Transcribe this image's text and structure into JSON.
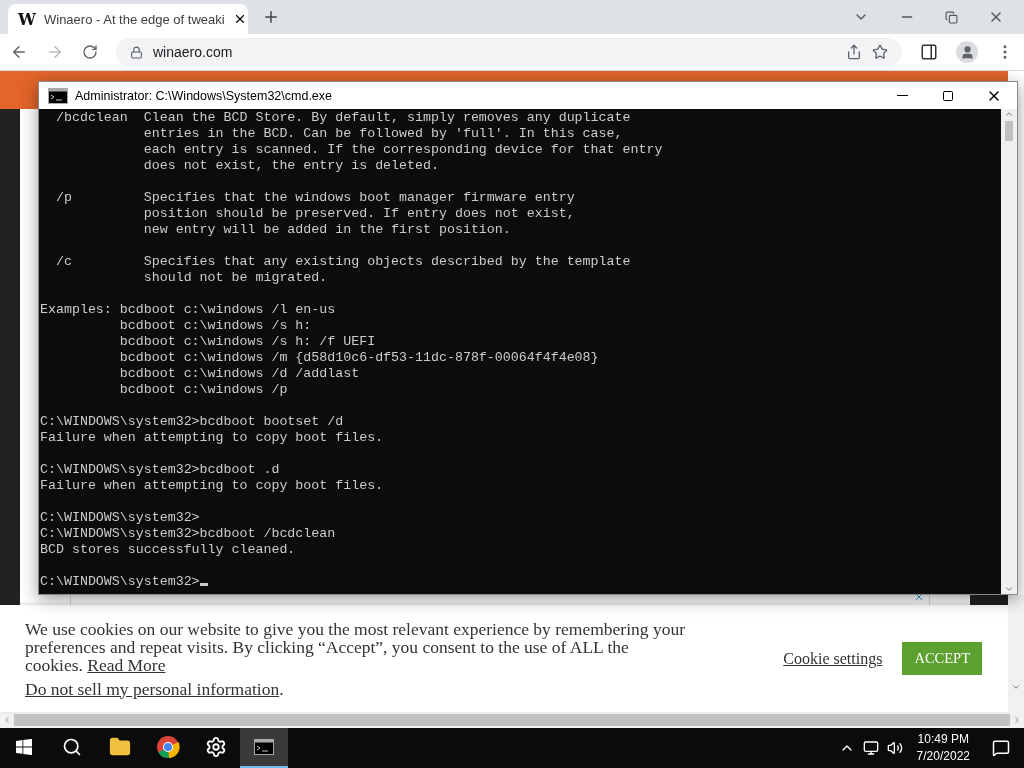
{
  "browser": {
    "tab": {
      "favicon": "W",
      "title": "Winaero - At the edge of tweaki",
      "selected": true
    },
    "address": "winaero.com"
  },
  "cmd_window": {
    "title": "Administrator: C:\\Windows\\System32\\cmd.exe",
    "blocks": [
      [
        "  /bcdclean  Clean the BCD Store. By default, simply removes any duplicate",
        "             entries in the BCD. Can be followed by 'full'. In this case,",
        "             each entry is scanned. If the corresponding device for that entry",
        "             does not exist, the entry is deleted."
      ],
      [
        "  /p         Specifies that the windows boot manager firmware entry",
        "             position should be preserved. If entry does not exist,",
        "             new entry will be added in the first position."
      ],
      [
        "  /c         Specifies that any existing objects described by the template",
        "             should not be migrated."
      ],
      [
        "Examples: bcdboot c:\\windows /l en-us",
        "          bcdboot c:\\windows /s h:",
        "          bcdboot c:\\windows /s h: /f UEFI",
        "          bcdboot c:\\windows /m {d58d10c6-df53-11dc-878f-00064f4f4e08}",
        "          bcdboot c:\\windows /d /addlast",
        "          bcdboot c:\\windows /p"
      ],
      [
        "C:\\WINDOWS\\system32>bcdboot bootset /d",
        "Failure when attempting to copy boot files."
      ],
      [
        "C:\\WINDOWS\\system32>bcdboot .d",
        "Failure when attempting to copy boot files."
      ],
      [
        "C:\\WINDOWS\\system32>",
        "C:\\WINDOWS\\system32>bcdboot /bcdclean",
        "BCD stores successfully cleaned."
      ],
      [
        "C:\\WINDOWS\\system32>"
      ]
    ]
  },
  "cookie_banner": {
    "text": "We use cookies on our website to give you the most relevant experience by remembering your preferences and repeat visits. By clicking “Accept”, you consent to the use of ALL the cookies.",
    "read_more": "Read More",
    "do_not_sell": "Do not sell my personal information",
    "do_not_sell_end": ".",
    "settings_link": "Cookie settings",
    "accept": "ACCEPT"
  },
  "taskbar": {
    "apps": [
      {
        "kind": "start",
        "selected": false
      },
      {
        "kind": "search",
        "selected": false
      },
      {
        "kind": "files",
        "selected": false
      },
      {
        "kind": "browser",
        "selected": false
      },
      {
        "kind": "settings",
        "selected": false
      },
      {
        "kind": "console",
        "selected": true
      }
    ],
    "time": "10:49 PM",
    "date": "7/20/2022"
  }
}
